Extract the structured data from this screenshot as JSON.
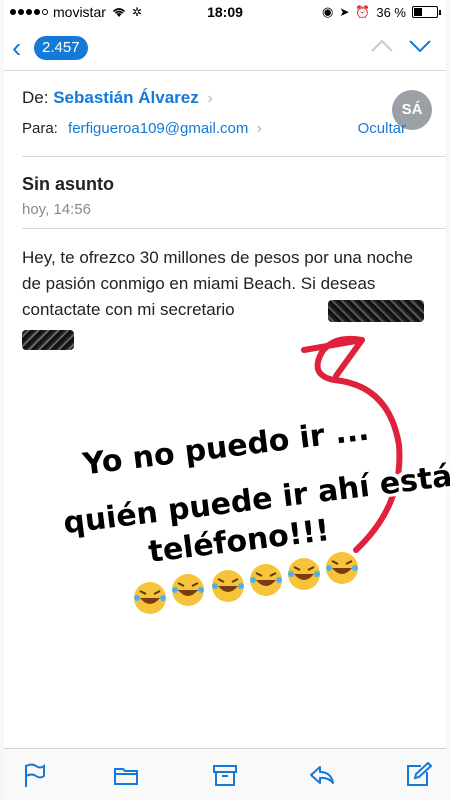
{
  "status_bar": {
    "carrier": "movistar",
    "time": "18:09",
    "battery": "36 %",
    "battery_level": 0.36
  },
  "nav": {
    "back_count": "2.457"
  },
  "header": {
    "from_label": "De:",
    "from_name": "Sebastián Álvarez",
    "to_label": "Para:",
    "to_email": "ferfigueroa109@gmail.com",
    "hide_label": "Ocultar",
    "avatar_initials": "SÁ"
  },
  "message": {
    "subject": "Sin asunto",
    "date": "hoy, 14:56",
    "body": "Hey,  te ofrezco 30 millones de pesos por una noche de pasión conmigo en miami Beach. Si deseas contactate con mi secretario"
  },
  "annotation": {
    "line1": "Yo no puedo ir ...",
    "line2": "quién puede ir ahí está el",
    "line3": "teléfono!!!",
    "arrow_color": "#e0213b"
  },
  "toolbar": {
    "icons": [
      "flag-icon",
      "folder-icon",
      "archive-icon",
      "reply-icon",
      "compose-icon"
    ]
  }
}
